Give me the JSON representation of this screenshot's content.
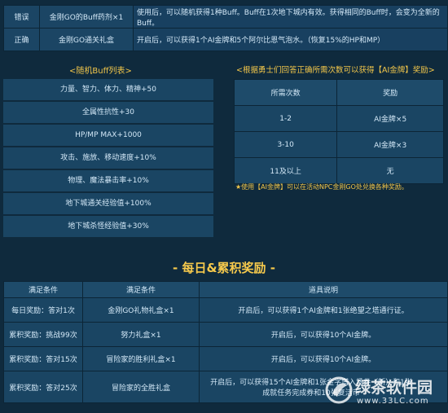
{
  "top_table": {
    "rows": [
      {
        "status": "错误",
        "item": "金刚GO的Buff药剂×1",
        "desc": "使用后，可以随机获得1种Buff。Buff在1次地下城内有效。获得相同的Buff时，会变为全新的Buff。"
      },
      {
        "status": "正确",
        "item": "金刚GO通关礼盒",
        "desc": "开启后，可以获得1个AI金牌和5个阿尔比恩气泡水。（恢复15%的HP和MP）"
      }
    ]
  },
  "buff_section": {
    "title": "<随机Buff列表>",
    "items": [
      "力量、智力、体力、精神+50",
      "全属性抗性+30",
      "HP/MP MAX+1000",
      "攻击、施放、移动速度+10%",
      "物理、魔法暴击率+10%",
      "地下城通关经验值+100%",
      "地下城杀怪经验值+30%"
    ]
  },
  "award_section": {
    "title": "<根据勇士们回答正确所需次数可以获得【AI金牌】奖励>",
    "headers": [
      "所需次数",
      "奖励"
    ],
    "rows": [
      {
        "count": "1-2",
        "reward": "AI金牌×5"
      },
      {
        "count": "3-10",
        "reward": "AI金牌×3"
      },
      {
        "count": "11及以上",
        "reward": "无"
      }
    ],
    "note": "★使用【AI金牌】可以在活动NPC金刚GO处兑换各种奖励。"
  },
  "daily_section": {
    "title": "- 每日&累积奖励 -",
    "headers": [
      "满足条件",
      "满足条件",
      "道具说明"
    ],
    "rows": [
      {
        "cond": "每日奖励：答对1次",
        "item": "金刚GO礼物礼盒×1",
        "desc": "开启后，可以获得1个AI金牌和1张绝望之塔通行证。"
      },
      {
        "cond": "累积奖励：挑战99次",
        "item": "努力礼盒×1",
        "desc": "开启后，可以获得10个AI金牌。"
      },
      {
        "cond": "累积奖励：答对15次",
        "item": "冒险家的胜利礼盒×1",
        "desc": "开启后，可以获得10个AI金牌。"
      },
      {
        "cond": "累积奖励：答对25次",
        "item": "冒险家的全胜礼盒",
        "desc": "开启后，可以获得15个AI金牌和1张金字塔入场券（新）和1张成就任务完成券和10张复活币"
      }
    ]
  },
  "watermark": {
    "brand": "绿茶软件园",
    "url": "www.33LC.com"
  }
}
